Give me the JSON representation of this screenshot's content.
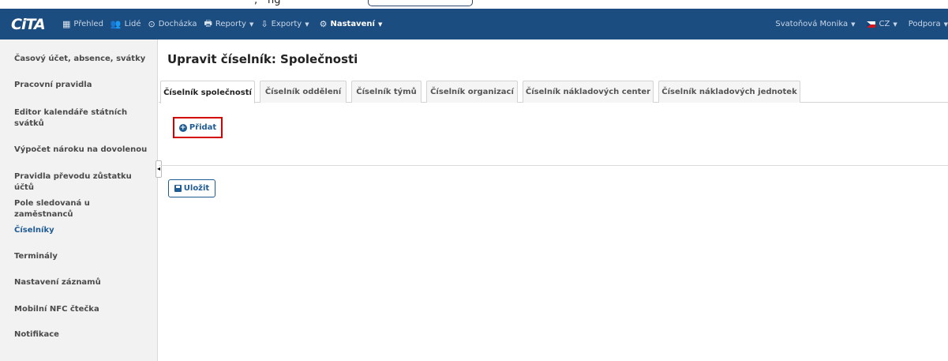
{
  "top_strip": {
    "comma": ",",
    "cropped_text": "ng"
  },
  "navbar": {
    "logo": "CiTA",
    "items": [
      {
        "icon": "grid-icon",
        "glyph": "▦",
        "label": "Přehled",
        "caret": ""
      },
      {
        "icon": "people-icon",
        "glyph": "👥",
        "label": "Lidé",
        "caret": ""
      },
      {
        "icon": "clock-icon",
        "glyph": "⊙",
        "label": "Docházka",
        "caret": ""
      },
      {
        "icon": "print-icon",
        "glyph": "🖶",
        "label": "Reporty",
        "caret": "▼"
      },
      {
        "icon": "export-icon",
        "glyph": "⇩",
        "label": "Exporty",
        "caret": "▼"
      },
      {
        "icon": "gear-icon",
        "glyph": "⚙",
        "label": "Nastavení",
        "caret": "▼"
      }
    ],
    "user": "Svatoňová Monika",
    "language": "CZ",
    "support": "Podpora",
    "caret": "▼"
  },
  "sidebar": {
    "items": [
      {
        "label": "Časový účet, absence, svátky"
      },
      {
        "label": "Pracovní pravidla"
      },
      {
        "label": "Editor kalendáře státních svátků"
      },
      {
        "label": "Výpočet nároku na dovolenou"
      },
      {
        "label": "Pravidla převodu zůstatku účtů"
      },
      {
        "label": "Pole sledovaná u zaměstnanců"
      },
      {
        "label": "Číselníky"
      },
      {
        "label": "Terminály"
      },
      {
        "label": "Nastavení záznamů"
      },
      {
        "label": "Mobilní NFC čtečka"
      },
      {
        "label": "Notifikace"
      }
    ],
    "active": "Číselníky",
    "collapse_glyph": "◂"
  },
  "main": {
    "title": "Upravit číselník: Společnosti",
    "tabs": [
      {
        "label": "Číselník společností"
      },
      {
        "label": "Číselník oddělení"
      },
      {
        "label": "Číselník týmů"
      },
      {
        "label": "Číselník organizací"
      },
      {
        "label": "Číselník nákladových center"
      },
      {
        "label": "Číselník nákladových jednotek"
      }
    ],
    "active_tab": "Číselník společností",
    "add_label": "Přidat",
    "add_glyph": "+",
    "save_label": "Uložit"
  },
  "colors": {
    "navbar": "#1c4d80",
    "accent": "#1f5c94",
    "highlight_border": "#d40000"
  }
}
